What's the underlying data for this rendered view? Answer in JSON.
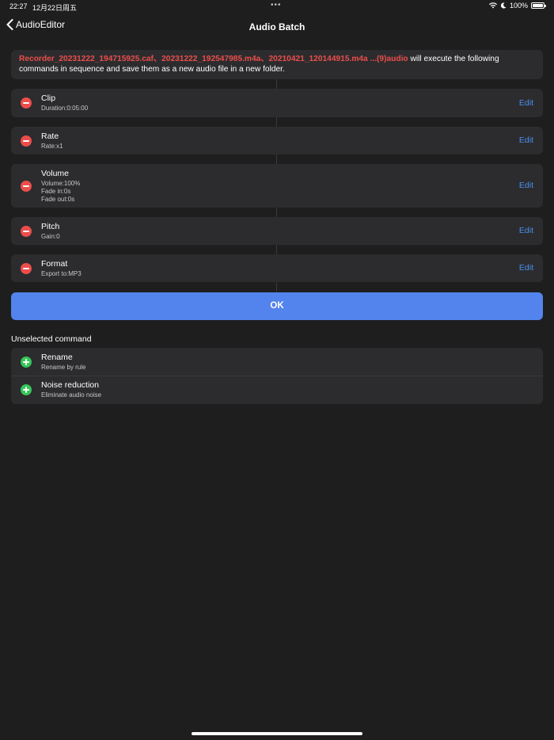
{
  "status_bar": {
    "time": "22:27",
    "date": "12月22日周五",
    "battery": "100%"
  },
  "nav": {
    "back_label": "AudioEditor",
    "title": "Audio Batch"
  },
  "info": {
    "files": "Recorder_20231222_194715925.caf、20231222_192547985.m4a、20210421_120144915.m4a ...(9)audio",
    "message": " will execute the following commands in sequence and save them as a new audio file in a new folder."
  },
  "commands": [
    {
      "title": "Clip",
      "details": [
        "Duration:0:05:00"
      ],
      "edit": "Edit"
    },
    {
      "title": "Rate",
      "details": [
        "Rate:x1"
      ],
      "edit": "Edit"
    },
    {
      "title": "Volume",
      "details": [
        "Volume:100%",
        "Fade in:0s",
        "Fade out:0s"
      ],
      "edit": "Edit"
    },
    {
      "title": "Pitch",
      "details": [
        "Gain:0"
      ],
      "edit": "Edit"
    },
    {
      "title": "Format",
      "details": [
        "Export to:MP3"
      ],
      "edit": "Edit"
    }
  ],
  "ok_label": "OK",
  "unselected": {
    "header": "Unselected command",
    "items": [
      {
        "title": "Rename",
        "subtitle": "Rename by rule"
      },
      {
        "title": "Noise reduction",
        "subtitle": "Eliminate audio noise"
      }
    ]
  },
  "colors": {
    "background": "#1e1e1f",
    "card": "#2c2c2e",
    "remove": "#eb4d4b",
    "add": "#35c759",
    "accent": "#5383ec",
    "link": "#4a8ff0"
  }
}
